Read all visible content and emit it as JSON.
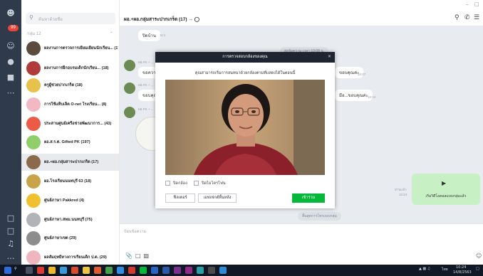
{
  "sidebar": {
    "search_placeholder": "ค้นหาด้วยชื่อ",
    "section_label": "กลุ่ม 12",
    "chats": [
      {
        "name": "ผลงานการตรวจการเยี่ยมเยียนนักเรียน...",
        "count": "(17)",
        "color": "#5b4a3e"
      },
      {
        "name": "ผลงานการฝึกอบรมเด็กนักเรียน...",
        "count": "(18)",
        "color": "#b13a3a"
      },
      {
        "name": "ครูผู้ช่วยปากเกร็ด",
        "count": "(18)",
        "color": "#e7c24a"
      },
      {
        "name": "การใช้แท็บเล็ต O-net โรงเรียน...",
        "count": "(8)",
        "color": "#f2b9c5"
      },
      {
        "name": "ประสานศูนย์เครือข่ายพัฒนาการ...",
        "count": "(43)",
        "color": "#ec5a48"
      },
      {
        "name": "ผอ.ส.ร.ต. Gifted PK",
        "count": "(197)",
        "color": "#8fcf6a"
      },
      {
        "name": "ผอ.+ผอ.กลุ่มสาระปากเกร็ด",
        "count": "(17)",
        "color": "#8a6a4a"
      },
      {
        "name": "ผอ.โรงเรียนนนทบุรี 63",
        "count": "(18)",
        "color": "#c9a34a"
      },
      {
        "name": "ศูนย์ภาษา Pakkred",
        "count": "(4)",
        "color": "#f1c02e"
      },
      {
        "name": "ศูนย์ภาษา.สพม.นนทบุรี",
        "count": "(75)",
        "color": "#b0b3b8"
      },
      {
        "name": "ศูนย์ภาษาเขต",
        "count": "(29)",
        "color": "#8d8d8d"
      },
      {
        "name": "ผลสัมฤทธิ์ทางการเรียนเด็ก ป.ต.",
        "count": "(29)",
        "color": "#f0b6c0"
      }
    ]
  },
  "header": {
    "title": "ผอ.+ผอ.กลุ่มสาระปากเกร็ด (17)"
  },
  "chat": {
    "top_bubble": "ปิดบ้าน",
    "top_time": "11:1",
    "date_chip": "ส่งข้อความ เวลา 10:08 น.",
    "senders": [
      {
        "name": "ผอ.PK + ...",
        "msg": "ขอความ",
        "time": "10:01"
      },
      {
        "name": "ผอ.PK + ...",
        "msg": "ขอบคุณ",
        "time": "10:01"
      },
      {
        "name": "ผอ.PK + ...",
        "msg": "",
        "time": ""
      }
    ],
    "right_bubble_1": "ขอบคุณค่ะ",
    "right_bubble_1_time": "10:07",
    "right_bubble_2": "มือ...ขอบคุณค่ะ",
    "right_bubble_2_time": "10:24",
    "video_call_label": "เริ่มวิดีโอคอลแบบกลุ่มแล้ว",
    "video_call_time": "10:24",
    "read_label": "อ่านแล้ว",
    "bottom_chip": "สิ้นสุดการโทรแบบกลุ่ม"
  },
  "input": {
    "placeholder": "ป้อนข้อความ"
  },
  "modal": {
    "title": "การตรวจสอบกล้องของคุณ",
    "message": "คุณสามารถเริ่มการสนทนาด้วยกล้องตามที่แสดงได้ในตอนนี้",
    "checkbox_1": "ปิดกล้อง",
    "checkbox_2": "ปิดไมโครโฟน",
    "btn_settings": "ฟิลเตอร์",
    "btn_effects": "เอฟเฟกต์พื้นหลัง",
    "btn_start": "เข้าร่วม"
  },
  "taskbar": {
    "time": "10:24",
    "date": "14/8/2563",
    "lang": "ไทย"
  }
}
